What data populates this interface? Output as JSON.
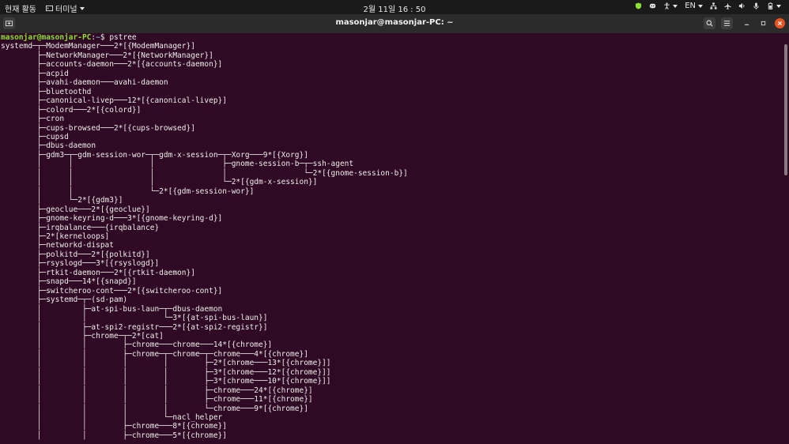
{
  "topbar": {
    "activities": "현재 활동",
    "app_menu": "터미널",
    "clock": "2월 11일  16 : 50",
    "language": "EN",
    "tray_icons": [
      "shield-icon",
      "discord-icon",
      "accessibility-icon",
      "network-icon",
      "airplane-icon",
      "volume-icon",
      "microphone-icon",
      "battery-icon"
    ]
  },
  "window": {
    "title": "masonjar@masonjar-PC: ~",
    "header_icons": [
      "new-tab-icon",
      "search-icon",
      "menu-icon",
      "minimize-icon",
      "maximize-icon",
      "close-icon"
    ],
    "close_color": "#e95420"
  },
  "terminal": {
    "prompt_user": "masonjar@masonjar-PC",
    "prompt_sep": ":",
    "prompt_path": "~",
    "prompt_end": "$ ",
    "command": "pstree",
    "lines": [
      "systemd─┬─ModemManager───2*[{ModemManager}]",
      "        ├─NetworkManager───2*[{NetworkManager}]",
      "        ├─accounts-daemon───2*[{accounts-daemon}]",
      "        ├─acpid",
      "        ├─avahi-daemon───avahi-daemon",
      "        ├─bluetoothd",
      "        ├─canonical-livep───12*[{canonical-livep}]",
      "        ├─colord───2*[{colord}]",
      "        ├─cron",
      "        ├─cups-browsed───2*[{cups-browsed}]",
      "        ├─cupsd",
      "        ├─dbus-daemon",
      "        ├─gdm3─┬─gdm-session-wor─┬─gdm-x-session─┬─Xorg───9*[{Xorg}]",
      "        │      │                 │               ├─gnome-session-b─┬─ssh-agent",
      "        │      │                 │               │                 └─2*[{gnome-session-b}]",
      "        │      │                 │               └─2*[{gdm-x-session}]",
      "        │      │                 └─2*[{gdm-session-wor}]",
      "        │      └─2*[{gdm3}]",
      "        ├─geoclue───2*[{geoclue}]",
      "        ├─gnome-keyring-d───3*[{gnome-keyring-d}]",
      "        ├─irqbalance───{irqbalance}",
      "        ├─2*[kerneloops]",
      "        ├─networkd-dispat",
      "        ├─polkitd───2*[{polkitd}]",
      "        ├─rsyslogd───3*[{rsyslogd}]",
      "        ├─rtkit-daemon───2*[{rtkit-daemon}]",
      "        ├─snapd───14*[{snapd}]",
      "        ├─switcheroo-cont───2*[{switcheroo-cont}]",
      "        ├─systemd─┬─(sd-pam)",
      "        │         ├─at-spi-bus-laun─┬─dbus-daemon",
      "        │         │                 └─3*[{at-spi-bus-laun}]",
      "        │         ├─at-spi2-registr───2*[{at-spi2-registr}]",
      "        │         ├─chrome─┬─2*[cat]",
      "        │         │        ├─chrome───chrome───14*[{chrome}]",
      "        │         │        ├─chrome─┬─chrome─┬─chrome───4*[{chrome}]",
      "        │         │        │        │        ├─2*[chrome───13*[{chrome}]]",
      "        │         │        │        │        ├─3*[chrome───12*[{chrome}]]",
      "        │         │        │        │        ├─3*[chrome───10*[{chrome}]]",
      "        │         │        │        │        ├─chrome───24*[{chrome}]",
      "        │         │        │        │        ├─chrome───11*[{chrome}]",
      "        │         │        │        │        └─chrome───9*[{chrome}]",
      "        │         │        │        └─nacl_helper",
      "        │         │        ├─chrome───8*[{chrome}]",
      "        │         │        ├─chrome───5*[{chrome}]"
    ]
  }
}
